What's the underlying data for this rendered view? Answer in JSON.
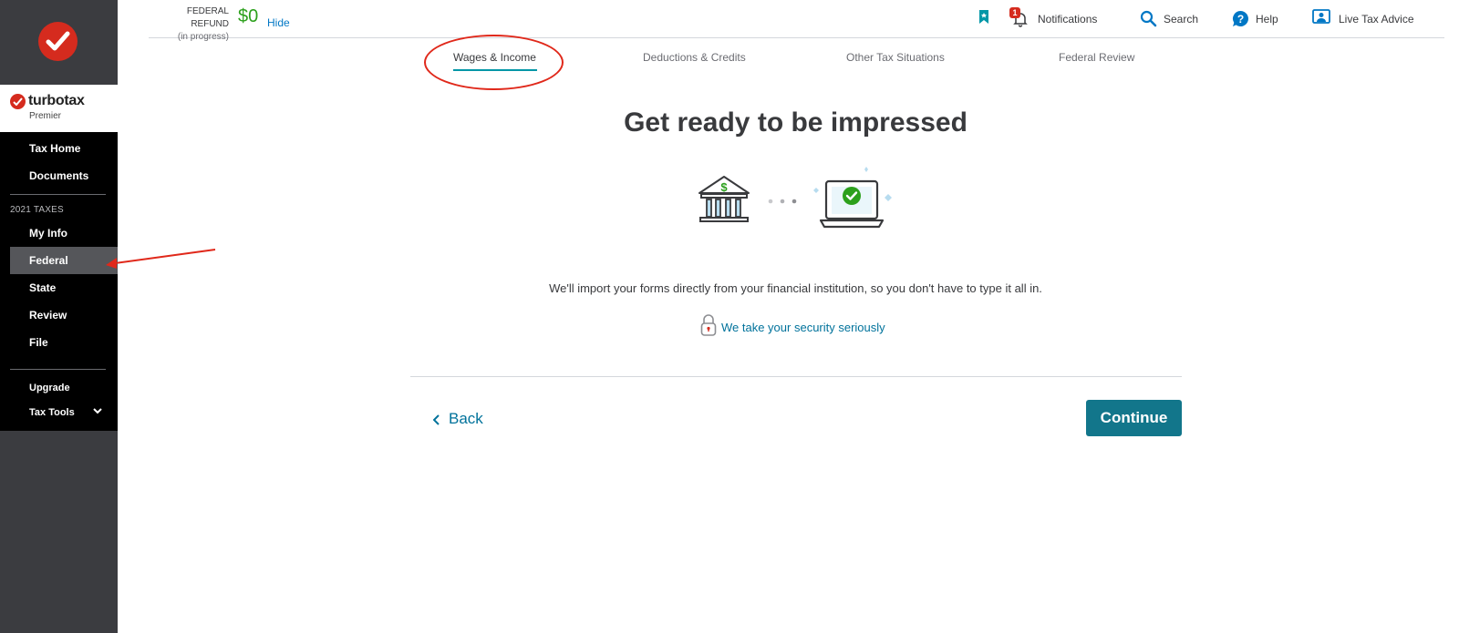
{
  "sidebar": {
    "brand_name": "turbotax",
    "brand_edition": "Premier",
    "nav_top": [
      {
        "label": "Tax Home"
      },
      {
        "label": "Documents"
      }
    ],
    "section_label": "2021 TAXES",
    "nav_taxes": [
      {
        "label": "My Info"
      },
      {
        "label": "Federal",
        "active": true
      },
      {
        "label": "State"
      },
      {
        "label": "Review"
      },
      {
        "label": "File"
      }
    ],
    "upgrade_label": "Upgrade",
    "tax_tools_label": "Tax Tools"
  },
  "topbar": {
    "refund_label": "FEDERAL REFUND",
    "refund_status": "(in progress)",
    "refund_amount": "$0",
    "hide_label": "Hide",
    "notifications_label": "Notifications",
    "notifications_count": "1",
    "search_label": "Search",
    "help_label": "Help",
    "live_advice_label": "Live Tax Advice"
  },
  "tabs": [
    {
      "label": "Wages & Income",
      "active": true
    },
    {
      "label": "Deductions & Credits"
    },
    {
      "label": "Other Tax Situations"
    },
    {
      "label": "Federal Review"
    }
  ],
  "main": {
    "title": "Get ready to be impressed",
    "description": "We'll import your forms directly from your financial institution, so you don't have to type it all in.",
    "security_link": "We take your security seriously",
    "back_label": "Back",
    "continue_label": "Continue"
  },
  "colors": {
    "brand_red": "#d52b1e",
    "accent_teal": "#12768b",
    "refund_green": "#2ca01c",
    "sidebar_dark": "#3b3c40",
    "annotation_red": "#e0281a"
  },
  "icons": [
    "checkmark-logo-icon",
    "bookmark-icon",
    "bell-icon",
    "search-icon",
    "help-icon",
    "live-advice-icon",
    "chevron-down-icon",
    "bank-icon",
    "laptop-check-icon",
    "lock-icon",
    "chevron-left-icon"
  ]
}
